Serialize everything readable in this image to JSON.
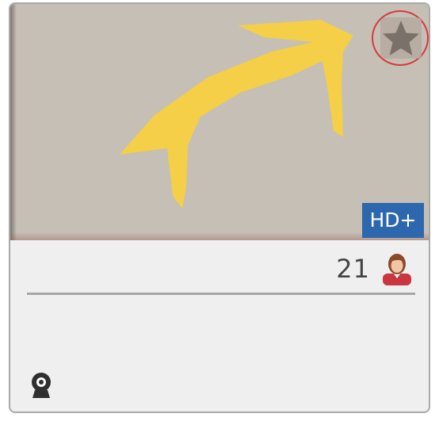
{
  "card": {
    "badge": "HD+",
    "viewer_count": "21",
    "icons": {
      "favorite": "star-icon",
      "viewers": "user-avatar-icon",
      "camera": "webcam-icon"
    }
  },
  "colors": {
    "thumbnail_bg": "#c5bfb6",
    "arrow": "#f4cf47",
    "badge_bg": "#2d67ad",
    "favorite_ring": "#d9383a",
    "card_bg": "#efefef"
  }
}
